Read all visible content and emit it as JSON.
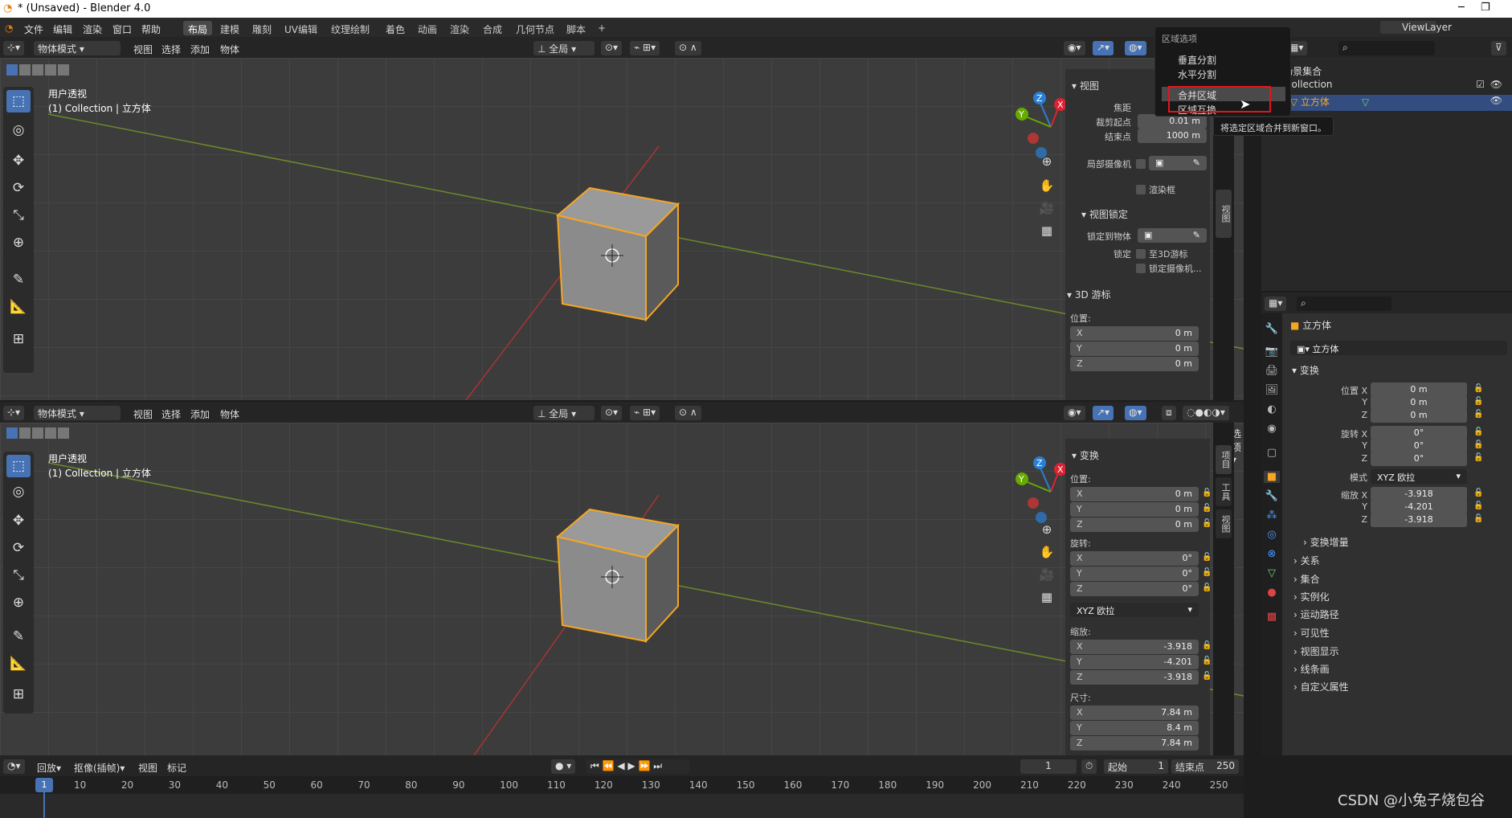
{
  "window": {
    "title": "* (Unsaved) - Blender 4.0",
    "minimize": "─",
    "maximize": "❐"
  },
  "menu": [
    "文件",
    "编辑",
    "渲染",
    "窗口",
    "帮助"
  ],
  "workspaces": [
    "布局",
    "建模",
    "雕刻",
    "UV编辑",
    "纹理绘制",
    "着色",
    "动画",
    "渲染",
    "合成",
    "几何节点",
    "脚本"
  ],
  "workspace_add": "+",
  "viewport_header": {
    "mode": "物体模式",
    "view": "视图",
    "select": "选择",
    "add": "添加",
    "object": "物体",
    "orientation": "全局",
    "options": "选项"
  },
  "viewport_top": {
    "view_name": "用户透视",
    "context": "(1) Collection | 立方体"
  },
  "viewport_bottom": {
    "view_name": "用户透视",
    "context": "(1) Collection | 立方体"
  },
  "gizmo": {
    "x": "X",
    "y": "Y",
    "z": "Z"
  },
  "npanel_top": {
    "view_title": "视图",
    "focal": "焦距",
    "clip_start_label": "裁剪起点",
    "clip_start": "0.01 m",
    "clip_end_label": "结束点",
    "clip_end": "1000 m",
    "local_camera": "局部摄像机",
    "render_region": "渲染框",
    "view_lock": "视图锁定",
    "lock_to_object": "锁定到物体",
    "lock_label": "锁定",
    "to_3d_cursor": "至3D游标",
    "lock_camera": "锁定摄像机...",
    "cursor_title": "3D 游标",
    "location_label": "位置:",
    "x": "X",
    "y": "Y",
    "z": "Z",
    "cx": "0 m",
    "cy": "0 m",
    "cz": "0 m"
  },
  "npanel_bottom": {
    "title": "变换",
    "location_label": "位置:",
    "lx": "0 m",
    "ly": "0 m",
    "lz": "0 m",
    "rotation_label": "旋转:",
    "rx": "0°",
    "ry": "0°",
    "rz": "0°",
    "rotation_mode": "XYZ 欧拉",
    "scale_label": "缩放:",
    "sx": "-3.918",
    "sy": "-4.201",
    "sz": "-3.918",
    "dims_label": "尺寸:",
    "dx": "7.84 m",
    "dy": "8.4 m",
    "dz": "7.84 m",
    "x": "X",
    "y": "Y",
    "z": "Z"
  },
  "side_tabs": [
    "项目",
    "工具",
    "视图"
  ],
  "area_menu": {
    "title": "区域选项",
    "items": [
      "垂直分割",
      "水平分割",
      "合并区域",
      "区域互换"
    ],
    "tooltip": "将选定区域合并到新窗口。"
  },
  "outliner": {
    "view_layer": "ViewLayer",
    "scene_collection": "场景集合",
    "collection": "Collection",
    "object": "立方体"
  },
  "properties": {
    "object_name": "立方体",
    "object_field": "立方体",
    "transform": "变换",
    "loc_label": "位置 X",
    "y_label": "Y",
    "z_label": "Z",
    "lx": "0 m",
    "ly": "0 m",
    "lz": "0 m",
    "rot_label": "旋转 X",
    "rx": "0°",
    "ry": "0°",
    "rz": "0°",
    "mode_label": "模式",
    "mode": "XYZ 欧拉",
    "scale_label": "缩放 X",
    "sx": "-3.918",
    "sy": "-4.201",
    "sz": "-3.918",
    "delta": "变换增量",
    "sections": [
      "关系",
      "集合",
      "实例化",
      "运动路径",
      "可见性",
      "视图显示",
      "线条画",
      "自定义属性"
    ]
  },
  "timeline": {
    "playback": "回放",
    "keying": "抠像(插帧)",
    "view": "视图",
    "marker": "标记",
    "current_frame": "1",
    "start_label": "起始",
    "start": "1",
    "end_label": "结束点",
    "end": "250",
    "ticks": [
      "10",
      "20",
      "30",
      "40",
      "50",
      "60",
      "70",
      "80",
      "90",
      "100",
      "110",
      "120",
      "130",
      "140",
      "150",
      "160",
      "170",
      "180",
      "190",
      "200",
      "210",
      "220",
      "230",
      "240",
      "250"
    ],
    "playhead": "1"
  },
  "watermark": "CSDN @小兔子烧包谷",
  "colors": {
    "accent": "#4772b3",
    "selection": "#f5a623",
    "highlight_box": "#e0161a"
  }
}
